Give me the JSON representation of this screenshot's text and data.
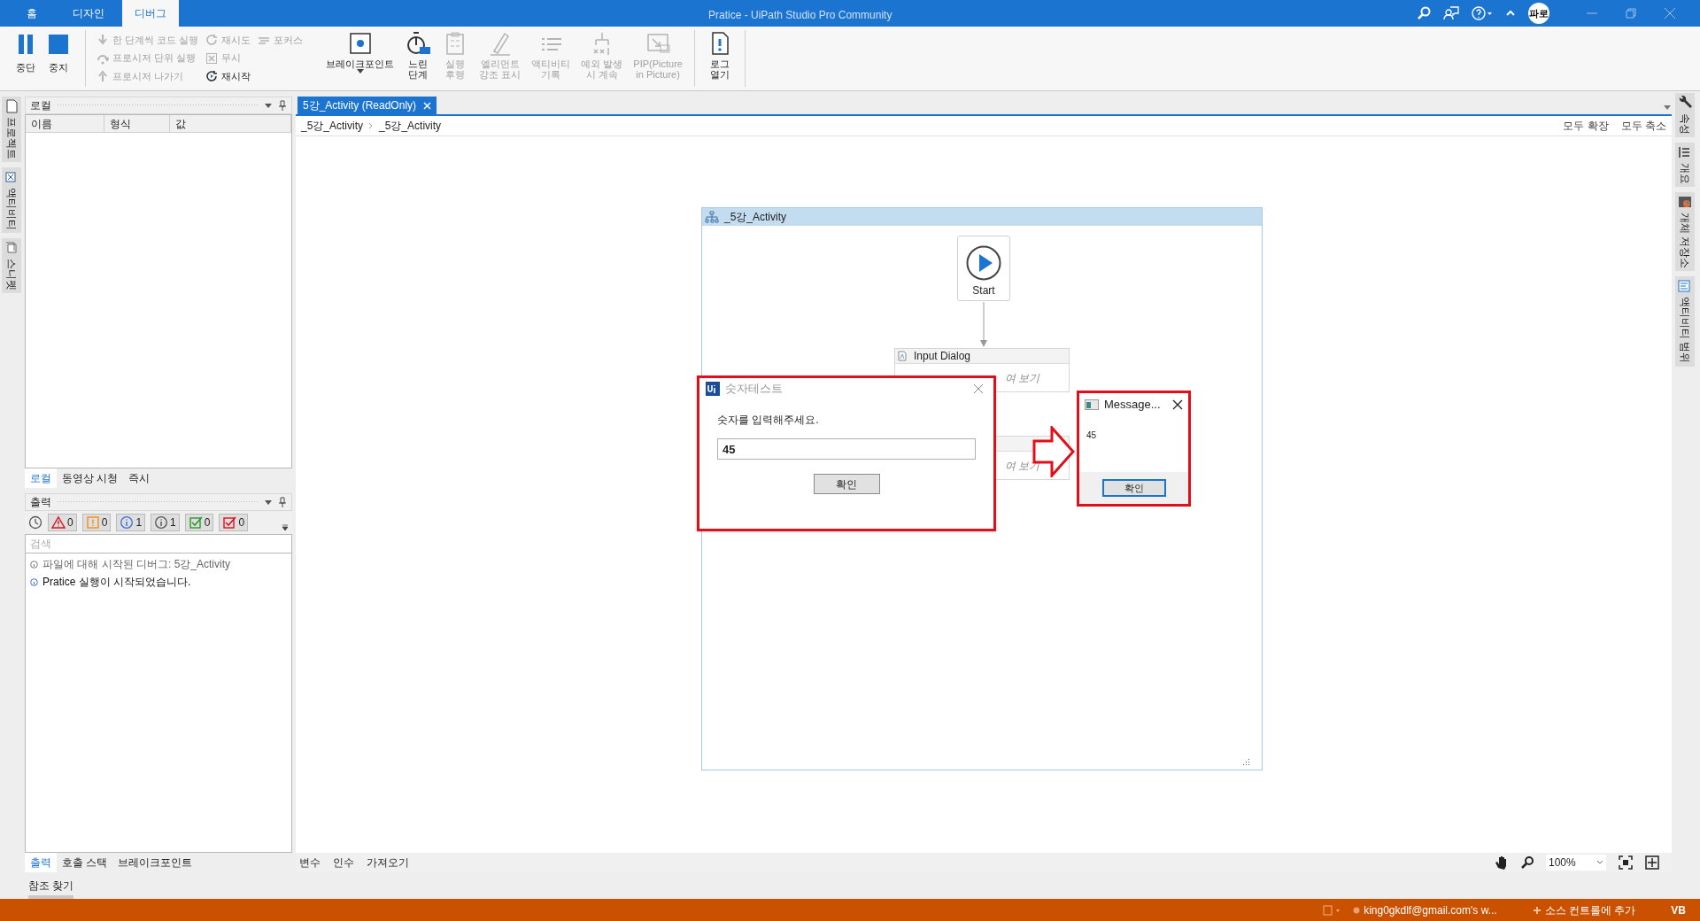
{
  "window": {
    "title": "Pratice - UiPath Studio Pro Community",
    "avatar": "파로"
  },
  "ribbon_tabs": [
    {
      "label": "홈",
      "selected": false
    },
    {
      "label": "디자인",
      "selected": false
    },
    {
      "label": "디버그",
      "selected": true
    }
  ],
  "ribbon": {
    "large_left": [
      {
        "label": "중단"
      },
      {
        "label": "중지"
      }
    ],
    "small": [
      {
        "label": "한 단계씩 코드 실행",
        "disabled": true
      },
      {
        "label": "프로시저 단위 실행",
        "disabled": true
      },
      {
        "label": "프로시저 나가기",
        "disabled": true
      },
      {
        "label": "재시도",
        "disabled": true
      },
      {
        "label": "무시",
        "disabled": true
      },
      {
        "label": "재시작",
        "disabled": false
      },
      {
        "label": "포커스",
        "disabled": true
      }
    ],
    "large": [
      {
        "label": "브레이크포인트",
        "disabled": false
      },
      {
        "label": "느린\n단계",
        "disabled": false
      },
      {
        "label": "실행\n후행",
        "disabled": true
      },
      {
        "label": "엘리먼트\n강조 표시",
        "disabled": true
      },
      {
        "label": "액티비티\n기록",
        "disabled": true
      },
      {
        "label": "예외 발생\n시 계속",
        "disabled": true
      },
      {
        "label": "PIP(Picture\nin Picture)",
        "disabled": true
      },
      {
        "label": "로그\n열기",
        "disabled": false
      }
    ]
  },
  "left_sidebar": [
    "프로젝트",
    "액티비티",
    "스니펫"
  ],
  "right_sidebar": [
    "속성",
    "개요",
    "개체 저장소",
    "액티비티 범위"
  ],
  "locals": {
    "title": "로컬",
    "columns": [
      "이름",
      "형식",
      "값"
    ],
    "tabs": [
      {
        "label": "로컬",
        "selected": true
      },
      {
        "label": "동영상 시청",
        "selected": false
      },
      {
        "label": "즉시",
        "selected": false
      }
    ]
  },
  "output": {
    "title": "출력",
    "filters": [
      {
        "kind": "error",
        "count": "0"
      },
      {
        "kind": "warning",
        "count": "0"
      },
      {
        "kind": "info",
        "count": "1"
      },
      {
        "kind": "trace",
        "count": "1"
      },
      {
        "kind": "success",
        "count": "0"
      },
      {
        "kind": "failure",
        "count": "0"
      }
    ],
    "search": {
      "placeholder": "검색"
    },
    "lines": [
      {
        "kind": "trace",
        "text": "파일에 대해 시작된 디버그: 5강_Activity"
      },
      {
        "kind": "info",
        "text": "Pratice 실행이 시작되었습니다."
      }
    ],
    "tabs": [
      {
        "label": "출력",
        "selected": true
      },
      {
        "label": "호출 스택",
        "selected": false
      },
      {
        "label": "브레이크포인트",
        "selected": false
      }
    ]
  },
  "find_references": "참조 찾기",
  "designer": {
    "tab": {
      "label": "5강_Activity (ReadOnly)",
      "selected": true
    },
    "breadcrumb": [
      "_5강_Activity",
      "_5강_Activity"
    ],
    "actions": [
      "모두 확장",
      "모두 축소"
    ],
    "flowchart": {
      "title": "_5강_Activity",
      "start": "Start",
      "activities": [
        {
          "title": "Input Dialog",
          "body": "여 보기"
        },
        {
          "body": "여 보기"
        }
      ]
    },
    "bottom_tabs": [
      "변수",
      "인수",
      "가져오기"
    ],
    "zoom": "100%"
  },
  "input_dialog": {
    "title": "숫자테스트",
    "prompt": "숫자를 입력해주세요.",
    "value": "45",
    "button": "확인"
  },
  "message_box": {
    "title": "Message...",
    "text": "45",
    "button": "확인"
  },
  "status_bar": [
    "king0gkdlf@gmail.com's w...",
    "소스 컨트롤에 추가",
    "VB"
  ]
}
